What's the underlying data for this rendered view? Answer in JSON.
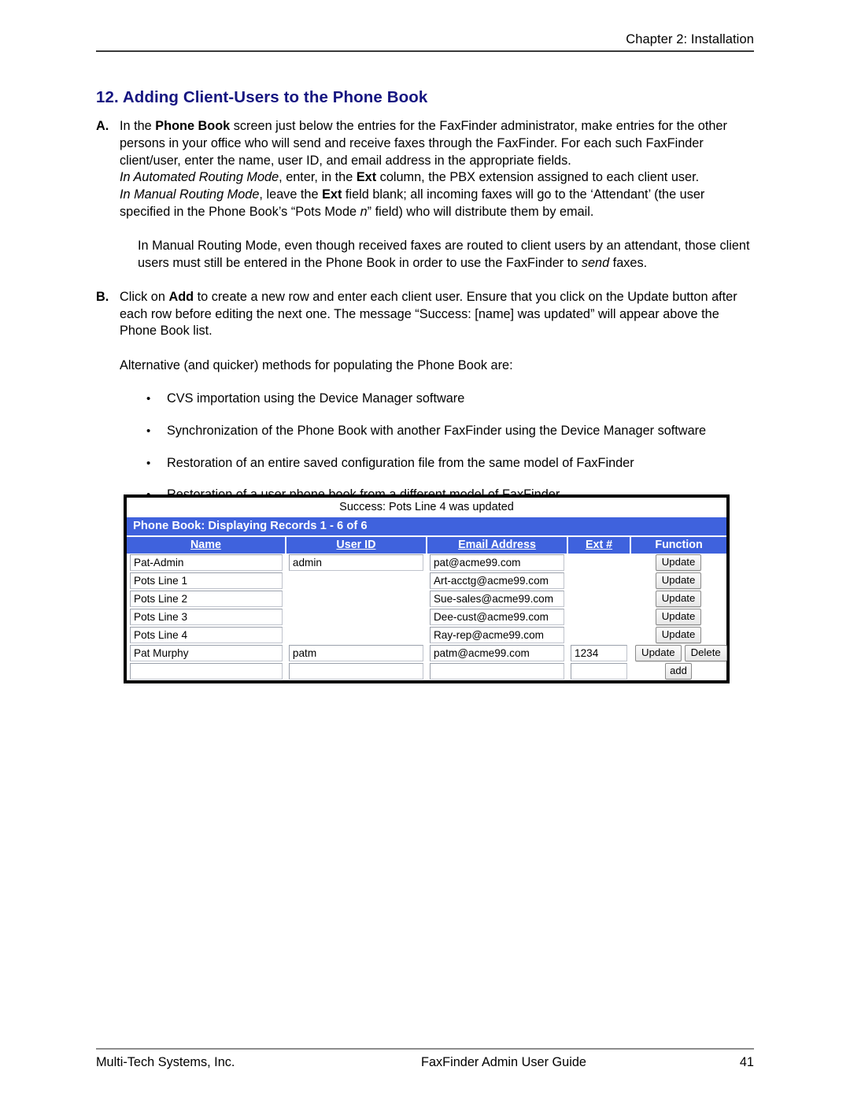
{
  "header": {
    "chapter": "Chapter 2: Installation"
  },
  "title": "12. Adding Client-Users to the Phone Book",
  "sections": {
    "a": {
      "marker": "A.",
      "line1_pre": "In the ",
      "line1_bold": "Phone Book",
      "line1_post": " screen just below the entries for the FaxFinder administrator, make entries for the other persons in your office who will send and receive faxes through the FaxFinder. For each such FaxFinder client/user, enter the name, user ID, and email address in the appropriate fields.",
      "auto_italic": "In Automated Routing Mode",
      "auto_mid": ", enter, in the ",
      "auto_bold": "Ext",
      "auto_post": " column, the PBX extension assigned to each client user.",
      "manual_italic": "In Manual Routing Mode",
      "manual_mid": ", leave the ",
      "manual_bold": "Ext",
      "manual_post": " field blank; all incoming faxes will go to the ‘Attendant’ (the user specified in the Phone Book’s “Pots Mode ",
      "manual_italic2": "n",
      "manual_post2": "” field) who will distribute them by email."
    },
    "note": {
      "pre": "In Manual Routing Mode, even though received faxes are routed to client users by an attendant, those client users must still be entered in the Phone Book in order to use the FaxFinder to ",
      "italic": "send",
      "post": " faxes."
    },
    "b": {
      "marker": "B.",
      "pre": "Click on ",
      "bold": "Add",
      "post": " to create a new row and enter each client user. Ensure that you click on the Update button after each row before editing the next one. The message “Success: [name] was updated” will appear above the Phone Book list."
    },
    "alternative_intro": "Alternative (and quicker) methods for populating the Phone Book are:",
    "bullets": [
      "CVS importation using the Device Manager software",
      "Synchronization of the Phone Book with another FaxFinder using the Device Manager software",
      "Restoration of an entire saved configuration file from the same model of FaxFinder",
      "Restoration of a user phone book from a different model of FaxFinder"
    ]
  },
  "screenshot": {
    "status_message": "Success: Pots Line 4 was updated",
    "panel_title": "Phone Book: Displaying Records 1 - 6 of 6",
    "columns": [
      "Name",
      "User ID",
      "Email Address",
      "Ext #",
      "Function"
    ],
    "rows": [
      {
        "name": "Pat-Admin",
        "user_id": "admin",
        "email": "pat@acme99.com",
        "ext": "",
        "buttons": [
          "Update"
        ]
      },
      {
        "name": "Pots Line 1",
        "user_id": "",
        "email": "Art-acctg@acme99.com",
        "ext": "",
        "buttons": [
          "Update"
        ]
      },
      {
        "name": "Pots Line 2",
        "user_id": "",
        "email": "Sue-sales@acme99.com",
        "ext": "",
        "buttons": [
          "Update"
        ]
      },
      {
        "name": "Pots Line 3",
        "user_id": "",
        "email": "Dee-cust@acme99.com",
        "ext": "",
        "buttons": [
          "Update"
        ]
      },
      {
        "name": "Pots Line 4",
        "user_id": "",
        "email": "Ray-rep@acme99.com",
        "ext": "",
        "buttons": [
          "Update"
        ]
      },
      {
        "name": "Pat Murphy",
        "user_id": "patm",
        "email": "patm@acme99.com",
        "ext": "1234",
        "buttons": [
          "Update",
          "Delete"
        ]
      },
      {
        "name": "",
        "user_id": "",
        "email": "",
        "ext": "",
        "buttons": [
          "add"
        ]
      }
    ],
    "colors": {
      "header_blue": "#3f62dd",
      "header_text": "#ffffff"
    }
  },
  "footer": {
    "company": "Multi-Tech Systems, Inc.",
    "guide": "FaxFinder Admin User Guide",
    "page_number": "41"
  }
}
